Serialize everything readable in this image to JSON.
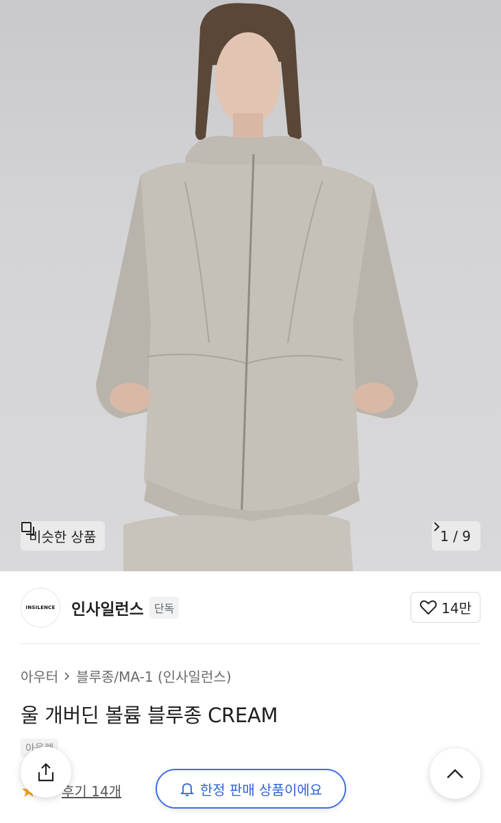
{
  "hero": {
    "similar_label": "비슷한 상품",
    "similar_icon": "copy-icon",
    "counter_text": "1 / 9",
    "counter_icon": "chevron-right-icon"
  },
  "brand": {
    "logo_text": "INSILENCE",
    "name": "인사일런스",
    "badge": "단독",
    "like_count": "14만",
    "like_icon": "heart-icon"
  },
  "breadcrumb": {
    "category": "아우터",
    "subcategory": "블루종/MA-1 (인사일런스)"
  },
  "product": {
    "title": "울 개버딘 볼륨 블루종 CREAM",
    "tag": "아울렛"
  },
  "review": {
    "text": "후기 14개"
  },
  "floating": {
    "share_icon": "share-icon",
    "top_icon": "chevron-up-icon",
    "limited_label": "한정 판매 상품이에요",
    "limited_icon": "bell-icon",
    "accent": "#3b6fe0"
  }
}
